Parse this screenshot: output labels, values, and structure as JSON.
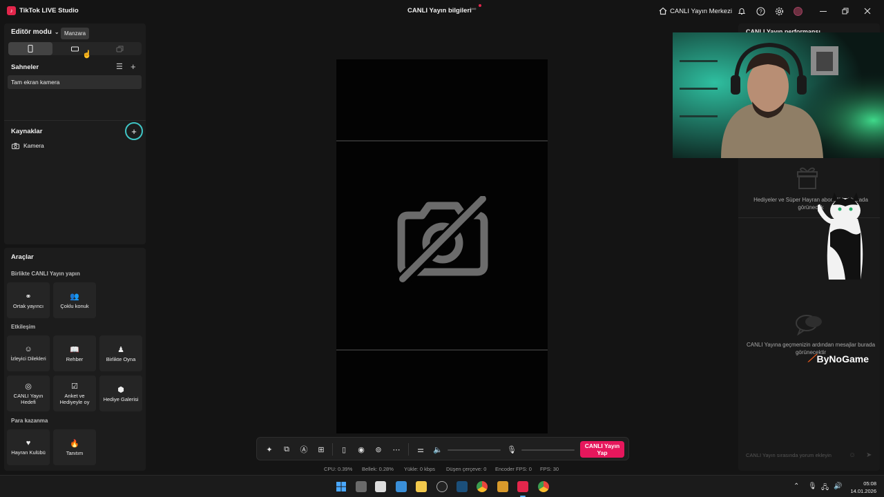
{
  "app": {
    "title": "TikTok LIVE Studio"
  },
  "header": {
    "live_info": "CANLI Yayın bilgileri",
    "live_center": "CANLI Yayın Merkezi"
  },
  "left": {
    "editor_mode": "Editör modu",
    "tooltip": "Manzara",
    "scenes_title": "Sahneler",
    "scene_item": "Tam ekran kamera",
    "sources_title": "Kaynaklar",
    "source_item": "Kamera"
  },
  "tools": {
    "title": "Araçlar",
    "group_collab": "Birlikte CANLI Yayın yapın",
    "group_interact": "Etkileşim",
    "group_money": "Para kazanma",
    "items": [
      {
        "label": "Ortak yayıncı",
        "icon": "link-icon"
      },
      {
        "label": "Çoklu konuk",
        "icon": "users-icon"
      },
      {
        "label": "İzleyici Dilekleri",
        "icon": "viewer-icon"
      },
      {
        "label": "Rehber",
        "icon": "book-icon"
      },
      {
        "label": "Birlikte Oyna",
        "icon": "play-together-icon"
      },
      {
        "label": "CANLI Yayın Hedefi",
        "icon": "target-icon"
      },
      {
        "label": "Anket ve Hediyeyle oy",
        "icon": "poll-icon"
      },
      {
        "label": "Hediye Galerisi",
        "icon": "gift-gallery-icon"
      },
      {
        "label": "Hayran Kulübü",
        "icon": "heart-icon"
      },
      {
        "label": "Tanıtım",
        "icon": "flame-icon"
      }
    ]
  },
  "controls": {
    "go_live": "CANLI Yayın Yap"
  },
  "stats": {
    "cpu": "CPU:  0.39%",
    "memory": "Bellek:  0.28%",
    "upload": "Yükle:  0 kbps",
    "dropped": "Düşen çerçeve:  0",
    "encoder_fps": "Encoder FPS:  0",
    "fps": "FPS:  30"
  },
  "right": {
    "title": "CANLI Yayın performansı",
    "gifts_empty": "Hediyeler ve Süper Hayran abonelikleri burada görünecek",
    "chat_empty": "CANLI Yayına geçmenizin ardından mesajlar burada görünecektir",
    "comment_placeholder": "CANLI Yayın sırasında yorum ekleyin"
  },
  "overlay": {
    "watermark": "ByNoGame"
  },
  "taskbar": {
    "time": "05:08",
    "date": "14.01.2026"
  },
  "colors": {
    "accent": "#e6175c",
    "highlight": "#3fc6c6"
  }
}
